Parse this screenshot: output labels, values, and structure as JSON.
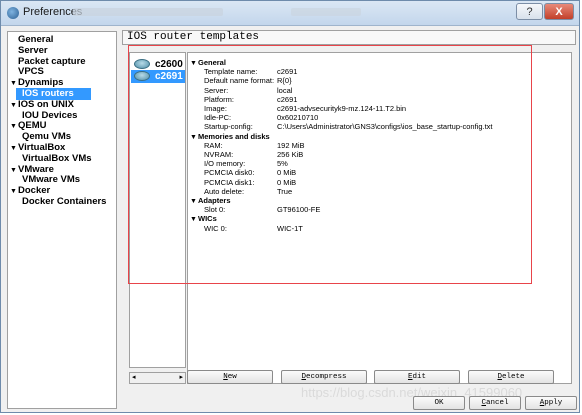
{
  "window": {
    "title": "Preferences",
    "help_label": "?",
    "close_label": "X"
  },
  "sidebar": {
    "items": [
      {
        "label": "General",
        "indent": 0,
        "arrow": "",
        "selected": false
      },
      {
        "label": "Server",
        "indent": 0,
        "arrow": "",
        "selected": false
      },
      {
        "label": "Packet capture",
        "indent": 0,
        "arrow": "",
        "selected": false
      },
      {
        "label": "VPCS",
        "indent": 0,
        "arrow": "",
        "selected": false
      },
      {
        "label": "Dynamips",
        "indent": 0,
        "arrow": "▼",
        "selected": false
      },
      {
        "label": "IOS routers",
        "indent": 1,
        "arrow": "",
        "selected": true
      },
      {
        "label": "IOS on UNIX",
        "indent": 0,
        "arrow": "▼",
        "selected": false
      },
      {
        "label": "IOU Devices",
        "indent": 1,
        "arrow": "",
        "selected": false
      },
      {
        "label": "QEMU",
        "indent": 0,
        "arrow": "▼",
        "selected": false
      },
      {
        "label": "Qemu VMs",
        "indent": 1,
        "arrow": "",
        "selected": false
      },
      {
        "label": "VirtualBox",
        "indent": 0,
        "arrow": "▼",
        "selected": false
      },
      {
        "label": "VirtualBox VMs",
        "indent": 1,
        "arrow": "",
        "selected": false
      },
      {
        "label": "VMware",
        "indent": 0,
        "arrow": "▼",
        "selected": false
      },
      {
        "label": "VMware VMs",
        "indent": 1,
        "arrow": "",
        "selected": false
      },
      {
        "label": "Docker",
        "indent": 0,
        "arrow": "▼",
        "selected": false
      },
      {
        "label": "Docker Containers",
        "indent": 1,
        "arrow": "",
        "selected": false
      }
    ]
  },
  "panel": {
    "title": "IOS router templates"
  },
  "templates": [
    {
      "label": "c2600",
      "icon": "router-icon",
      "selected": false
    },
    {
      "label": "c2691",
      "icon": "router-icon",
      "selected": true
    }
  ],
  "list_scroll": {
    "left": "◂",
    "right": "▸"
  },
  "details": {
    "sections": [
      {
        "title": "General",
        "rows": [
          {
            "key": "Template name:",
            "value": "c2691"
          },
          {
            "key": "Default name format:",
            "value": "R{0}"
          },
          {
            "key": "Server:",
            "value": "local"
          },
          {
            "key": "Platform:",
            "value": "c2691"
          },
          {
            "key": "Image:",
            "value": "c2691-advsecurityk9-mz.124-11.T2.bin"
          },
          {
            "key": "Idle-PC:",
            "value": "0x60210710"
          },
          {
            "key": "Startup-config:",
            "value": "C:\\Users\\Administrator\\GNS3\\configs\\ios_base_startup-config.txt"
          }
        ]
      },
      {
        "title": "Memories and disks",
        "rows": [
          {
            "key": "RAM:",
            "value": "192 MiB"
          },
          {
            "key": "NVRAM:",
            "value": "256 KiB"
          },
          {
            "key": "I/O memory:",
            "value": "5%"
          },
          {
            "key": "PCMCIA disk0:",
            "value": "0 MiB"
          },
          {
            "key": "PCMCIA disk1:",
            "value": "0 MiB"
          },
          {
            "key": "Auto delete:",
            "value": "True"
          }
        ]
      },
      {
        "title": "Adapters",
        "rows": [
          {
            "key": "Slot 0:",
            "value": "GT96100-FE"
          }
        ]
      },
      {
        "title": "WICs",
        "rows": [
          {
            "key": "WIC 0:",
            "value": "WIC-1T"
          }
        ]
      }
    ]
  },
  "actions": {
    "new": {
      "first": "N",
      "rest": "ew"
    },
    "decompress": {
      "first": "D",
      "rest": "ecompress"
    },
    "edit": {
      "first": "E",
      "rest": "dit"
    },
    "delete": {
      "first": "D",
      "rest": "elete"
    }
  },
  "footer": {
    "ok": {
      "first": "",
      "rest": "OK"
    },
    "cancel": {
      "first": "C",
      "rest": "ancel"
    },
    "apply": {
      "first": "A",
      "rest": "pply"
    }
  },
  "watermark": "https://blog.csdn.net/weixin_41599060"
}
